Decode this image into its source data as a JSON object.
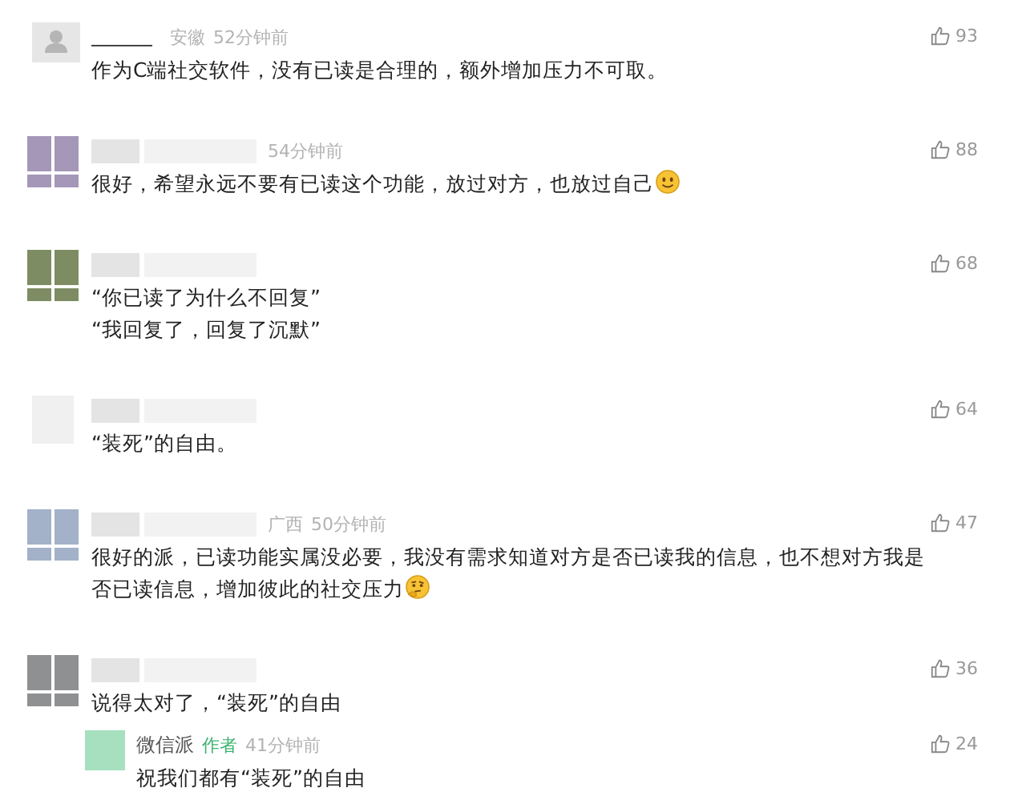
{
  "comments": [
    {
      "avatar": {
        "kind": "person",
        "color": "#e6e6e6"
      },
      "name": {
        "kind": "redacted_line"
      },
      "location": "安徽",
      "time": "52分钟前",
      "text": "作为C端社交软件，没有已读是合理的，额外增加压力不可取。",
      "likes": "93"
    },
    {
      "avatar": {
        "kind": "tiles",
        "color": "#a497b8"
      },
      "name": {
        "kind": "redacted_blocks"
      },
      "time": "54分钟前",
      "text": "很好，希望永远不要有已读这个功能，放过对方，也放过自己",
      "emoji": {
        "kind": "smile"
      },
      "likes": "88"
    },
    {
      "avatar": {
        "kind": "tiles",
        "color": "#7d8c62"
      },
      "name": {
        "kind": "redacted_blocks"
      },
      "lines": [
        "“你已读了为什么不回复”",
        "“我回复了，回复了沉默”"
      ],
      "likes": "68"
    },
    {
      "avatar": {
        "kind": "plain",
        "color": "#f0f0f0"
      },
      "name": {
        "kind": "redacted_blocks"
      },
      "text": "“装死”的自由。",
      "likes": "64"
    },
    {
      "avatar": {
        "kind": "tiles",
        "color": "#a3b1c9"
      },
      "name": {
        "kind": "redacted_blocks"
      },
      "location": "广西",
      "time": "50分钟前",
      "text": "很好的派，已读功能实属没必要，我没有需求知道对方是否已读我的信息，也不想对方我是否已读信息，增加彼此的社交压力",
      "emoji": {
        "kind": "thinking"
      },
      "likes": "47"
    },
    {
      "avatar": {
        "kind": "tiles",
        "color": "#8f9092"
      },
      "name": {
        "kind": "redacted_blocks"
      },
      "text": "说得太对了，“装死”的自由",
      "likes": "36",
      "replies": [
        {
          "avatar": {
            "kind": "plain",
            "color": "#a6e0bf"
          },
          "name": "微信派",
          "tag": "作者",
          "time": "41分钟前",
          "text": "祝我们都有“装死”的自由",
          "likes": "24"
        }
      ]
    }
  ]
}
